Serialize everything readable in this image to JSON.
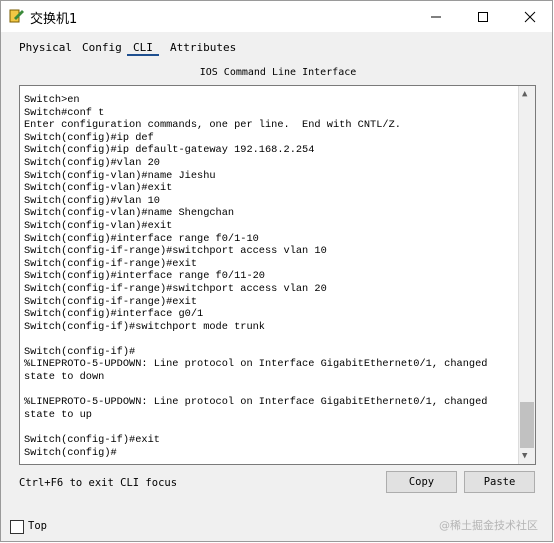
{
  "window": {
    "title": "交换机1",
    "minimize": "—",
    "maximize": "☐",
    "close": "✕"
  },
  "tabs": [
    {
      "label": "Physical"
    },
    {
      "label": "Config"
    },
    {
      "label": "CLI"
    },
    {
      "label": "Attributes"
    }
  ],
  "header": {
    "title": "IOS Command Line Interface"
  },
  "console": {
    "lines": [
      "Switch>en",
      "Switch#conf t",
      "Enter configuration commands, one per line.  End with CNTL/Z.",
      "Switch(config)#ip def",
      "Switch(config)#ip default-gateway 192.168.2.254",
      "Switch(config)#vlan 20",
      "Switch(config-vlan)#name Jieshu",
      "Switch(config-vlan)#exit",
      "Switch(config)#vlan 10",
      "Switch(config-vlan)#name Shengchan",
      "Switch(config-vlan)#exit",
      "Switch(config)#interface range f0/1-10",
      "Switch(config-if-range)#switchport access vlan 10",
      "Switch(config-if-range)#exit",
      "Switch(config)#interface range f0/11-20",
      "Switch(config-if-range)#switchport access vlan 20",
      "Switch(config-if-range)#exit",
      "Switch(config)#interface g0/1",
      "Switch(config-if)#switchport mode trunk",
      "",
      "Switch(config-if)#",
      "%LINEPROTO-5-UPDOWN: Line protocol on Interface GigabitEthernet0/1, changed",
      "state to down",
      "",
      "%LINEPROTO-5-UPDOWN: Line protocol on Interface GigabitEthernet0/1, changed",
      "state to up",
      "",
      "Switch(config-if)#exit",
      "Switch(config)#"
    ]
  },
  "footer": {
    "hint": "Ctrl+F6 to exit CLI focus",
    "copy_label": "Copy",
    "paste_label": "Paste",
    "top_label": "Top",
    "watermark": "@稀土掘金技术社区"
  }
}
